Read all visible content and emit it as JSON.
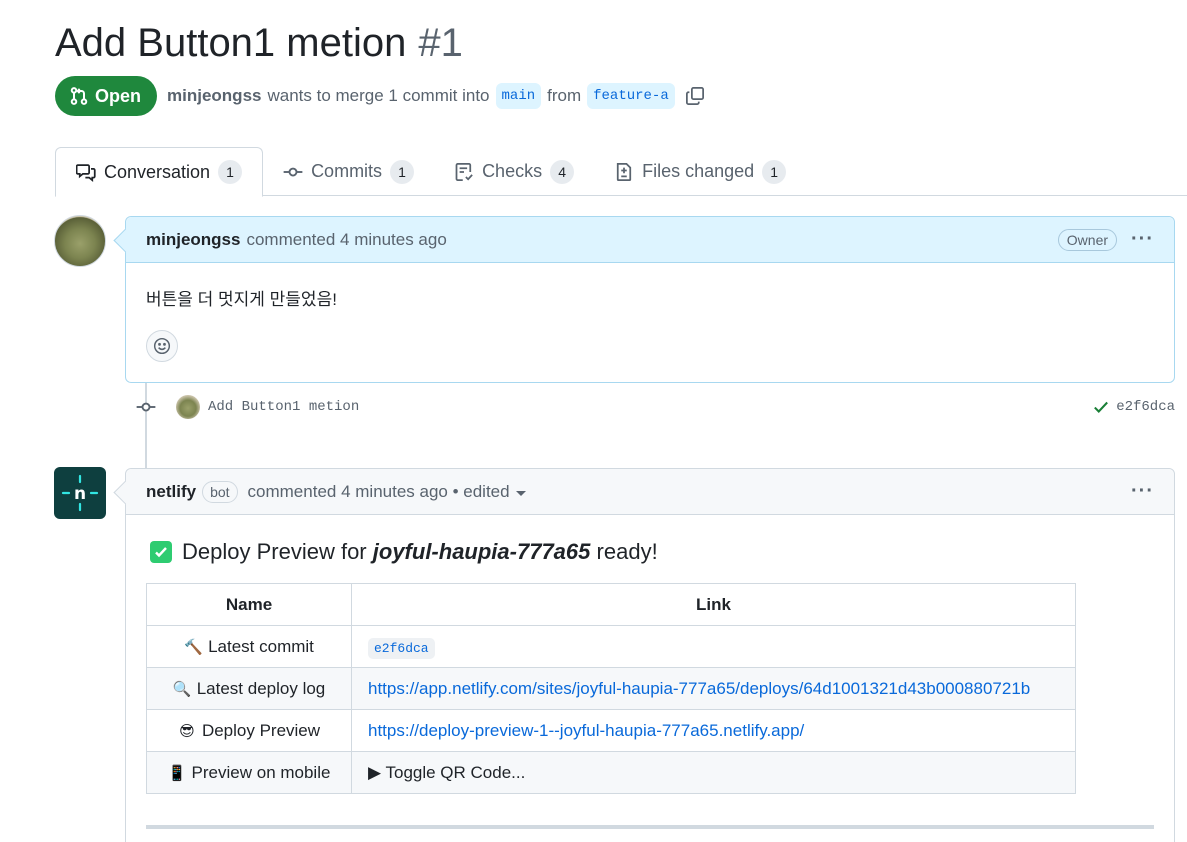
{
  "pr": {
    "title": "Add Button1 metion",
    "number": "#1",
    "state": "Open",
    "author": "minjeongss",
    "merge_text": "wants to merge 1 commit into",
    "base_branch": "main",
    "from_text": "from",
    "head_branch": "feature-a"
  },
  "tabs": [
    {
      "label": "Conversation",
      "count": "1",
      "icon": "comment-discussion-icon",
      "active": true
    },
    {
      "label": "Commits",
      "count": "1",
      "icon": "git-commit-icon",
      "active": false
    },
    {
      "label": "Checks",
      "count": "4",
      "icon": "checklist-icon",
      "active": false
    },
    {
      "label": "Files changed",
      "count": "1",
      "icon": "file-diff-icon",
      "active": false
    }
  ],
  "comments": [
    {
      "author": "minjeongss",
      "meta": "commented 4 minutes ago",
      "role_label": "Owner",
      "body": "버튼을 더 멋지게 만들었음!"
    }
  ],
  "commit": {
    "message": "Add Button1 metion",
    "sha": "e2f6dca",
    "status": "success"
  },
  "bot_comment": {
    "author": "netlify",
    "bot_label": "bot",
    "meta": "commented 4 minutes ago • edited",
    "heading_prefix": "Deploy Preview for",
    "site_name": "joyful-haupia-777a65",
    "heading_suffix": "ready!",
    "table": {
      "headers": [
        "Name",
        "Link"
      ],
      "rows": [
        {
          "icon": "🔨",
          "name": "Latest commit",
          "value": "e2f6dca",
          "kind": "code"
        },
        {
          "icon": "🔍",
          "name": "Latest deploy log",
          "value": "https://app.netlify.com/sites/joyful-haupia-777a65/deploys/64d1001321d43b000880721b",
          "kind": "link"
        },
        {
          "icon": "😎",
          "name": "Deploy Preview",
          "value": "https://deploy-preview-1--joyful-haupia-777a65.netlify.app/",
          "kind": "link"
        },
        {
          "icon": "📱",
          "name": "Preview on mobile",
          "value": "▶ Toggle QR Code...",
          "kind": "toggle"
        }
      ]
    }
  },
  "colors": {
    "open_green": "#1f883d",
    "link_blue": "#0969da",
    "owner_header_bg": "#ddf4ff",
    "netlify_bg": "#0e3f3f",
    "netlify_accent": "#32e6e2"
  }
}
